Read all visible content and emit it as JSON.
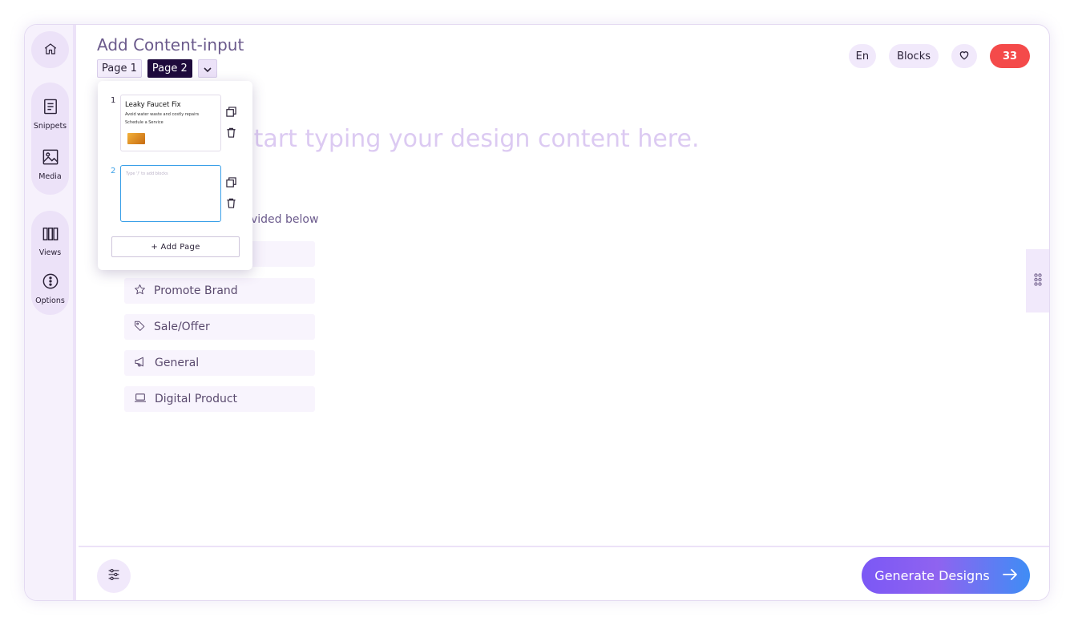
{
  "header": {
    "title": "Add Content-input",
    "pages": [
      "Page 1",
      "Page 2"
    ],
    "language": "En",
    "blocks_label": "Blocks",
    "count": "33"
  },
  "sidebar": {
    "items": [
      {
        "label": "Snippets",
        "icon": "document-icon"
      },
      {
        "label": "Media",
        "icon": "image-icon"
      },
      {
        "label": "Views",
        "icon": "columns-icon"
      },
      {
        "label": "Options",
        "icon": "more-vertical-icon"
      }
    ]
  },
  "main": {
    "placeholder": "start typing your design content here.",
    "hint": "vided below",
    "categories": [
      {
        "label": "Promote Brand",
        "icon": "star-icon"
      },
      {
        "label": "Sale/Offer",
        "icon": "tag-icon"
      },
      {
        "label": "General",
        "icon": "megaphone-icon"
      },
      {
        "label": "Digital Product",
        "icon": "laptop-icon"
      }
    ]
  },
  "pages_dropdown": {
    "pages": [
      {
        "number": "1",
        "title": "Leaky Faucet Fix",
        "subtitle": "Avoid water waste and costly repairs",
        "cta": "Schedule a Service"
      },
      {
        "number": "2",
        "placeholder": "Type '/' to add blocks"
      }
    ],
    "add_page_label": "+ Add Page"
  },
  "footer": {
    "generate_label": "Generate Designs"
  },
  "colors": {
    "accent": "#7b58f5",
    "count_badge": "#f44a4a",
    "active_page": "#1e0a3c",
    "selected_border": "#3aa0e8"
  }
}
